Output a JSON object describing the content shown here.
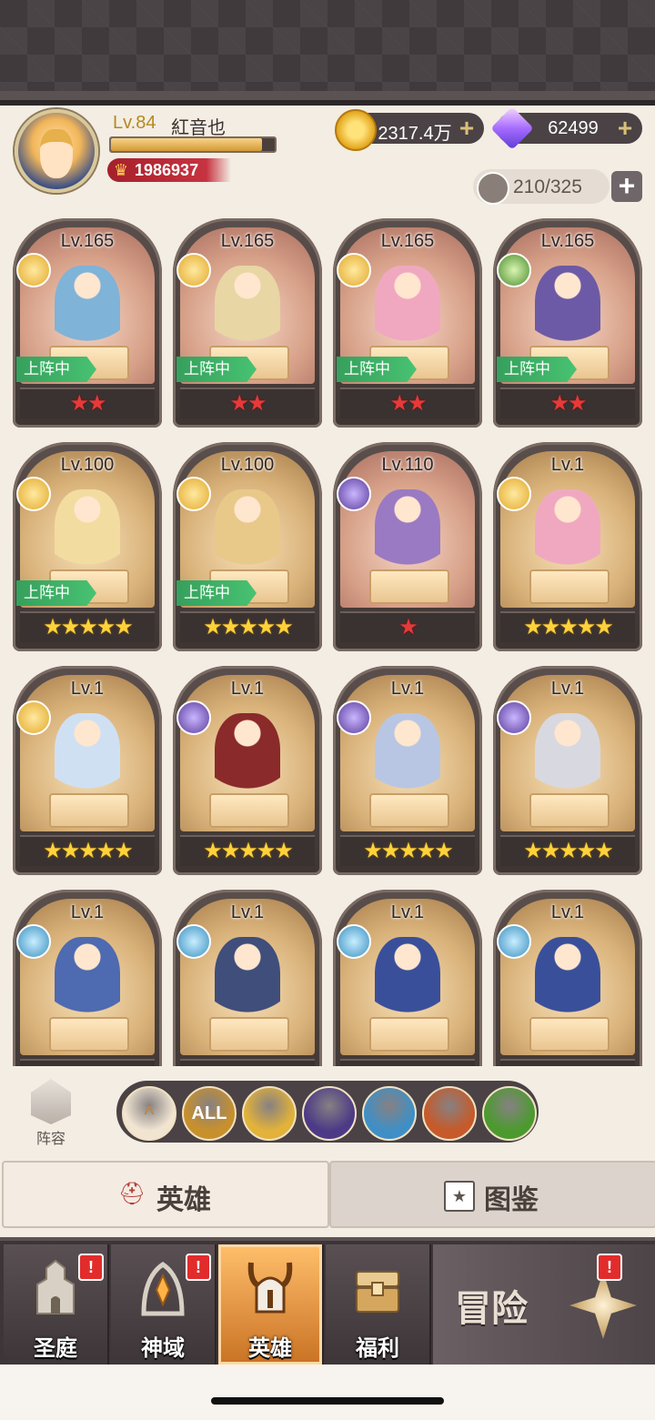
{
  "player": {
    "level": "Lv.84",
    "name": "紅音也",
    "xp_fraction": 0.92,
    "power": "1986937"
  },
  "currencies": {
    "gold": "2317.4万",
    "gems": "62499",
    "plus": "+"
  },
  "capacity": "210/325",
  "heroes": [
    {
      "level": "Lv.165",
      "faction": "light",
      "deployed": true,
      "stars": "★★",
      "star_color": "red",
      "bg": "warm"
    },
    {
      "level": "Lv.165",
      "faction": "light",
      "deployed": true,
      "stars": "★★",
      "star_color": "red",
      "bg": "warm"
    },
    {
      "level": "Lv.165",
      "faction": "light",
      "deployed": true,
      "stars": "★★",
      "star_color": "red",
      "bg": "warm"
    },
    {
      "level": "Lv.165",
      "faction": "nature",
      "deployed": true,
      "stars": "★★",
      "star_color": "red",
      "bg": "warm"
    },
    {
      "level": "Lv.100",
      "faction": "light",
      "deployed": true,
      "stars": "★★★★★",
      "star_color": "gold",
      "bg": "gold"
    },
    {
      "level": "Lv.100",
      "faction": "light",
      "deployed": true,
      "stars": "★★★★★",
      "star_color": "gold",
      "bg": "gold"
    },
    {
      "level": "Lv.110",
      "faction": "dark",
      "deployed": false,
      "stars": "★",
      "star_color": "red",
      "bg": "warm"
    },
    {
      "level": "Lv.1",
      "faction": "light",
      "deployed": false,
      "stars": "★★★★★",
      "star_color": "gold",
      "bg": "gold"
    },
    {
      "level": "Lv.1",
      "faction": "light",
      "deployed": false,
      "stars": "★★★★★",
      "star_color": "gold",
      "bg": "gold"
    },
    {
      "level": "Lv.1",
      "faction": "dark",
      "deployed": false,
      "stars": "★★★★★",
      "star_color": "gold",
      "bg": "gold"
    },
    {
      "level": "Lv.1",
      "faction": "dark",
      "deployed": false,
      "stars": "★★★★★",
      "star_color": "gold",
      "bg": "gold"
    },
    {
      "level": "Lv.1",
      "faction": "dark",
      "deployed": false,
      "stars": "★★★★★",
      "star_color": "gold",
      "bg": "gold"
    },
    {
      "level": "Lv.1",
      "faction": "holy",
      "deployed": false,
      "stars": "",
      "star_color": "gold",
      "bg": "gold"
    },
    {
      "level": "Lv.1",
      "faction": "holy",
      "deployed": false,
      "stars": "",
      "star_color": "gold",
      "bg": "gold"
    },
    {
      "level": "Lv.1",
      "faction": "holy",
      "deployed": false,
      "stars": "",
      "star_color": "gold",
      "bg": "gold"
    },
    {
      "level": "Lv.1",
      "faction": "holy",
      "deployed": false,
      "stars": "",
      "star_color": "gold",
      "bg": "gold"
    }
  ],
  "deployed_label": "上阵中",
  "formation_label": "阵容",
  "filters": [
    {
      "name": "sort-icon",
      "label": "^",
      "color": "#f1e5d2",
      "text": "#b8894a"
    },
    {
      "name": "all-filter",
      "label": "ALL",
      "color": "#c8902c",
      "text": "#ffffff"
    },
    {
      "name": "light-faction-icon",
      "label": "",
      "color": "#e2b23a",
      "text": "#ffffff"
    },
    {
      "name": "dark-faction-icon",
      "label": "",
      "color": "#4d3a86",
      "text": "#ffffff"
    },
    {
      "name": "holy-faction-icon",
      "label": "",
      "color": "#3f8fc6",
      "text": "#ffffff"
    },
    {
      "name": "beast-faction-icon",
      "label": "",
      "color": "#c65a2a",
      "text": "#ffffff"
    },
    {
      "name": "nature-faction-icon",
      "label": "",
      "color": "#4c9a2f",
      "text": "#ffffff"
    }
  ],
  "tabs": {
    "hero": "英雄",
    "atlas": "图鉴"
  },
  "nav": [
    {
      "label": "圣庭",
      "badge": "!",
      "active": false
    },
    {
      "label": "神域",
      "badge": "!",
      "active": false
    },
    {
      "label": "英雄",
      "badge": "",
      "active": true
    },
    {
      "label": "福利",
      "badge": "",
      "active": false
    }
  ],
  "adventure": {
    "label": "冒险",
    "badge": "!"
  },
  "colors": {
    "accent_gold": "#b48a1f",
    "deploy_green": "#35a05c",
    "power_red": "#a5202a",
    "badge_red": "#e22c2c"
  }
}
